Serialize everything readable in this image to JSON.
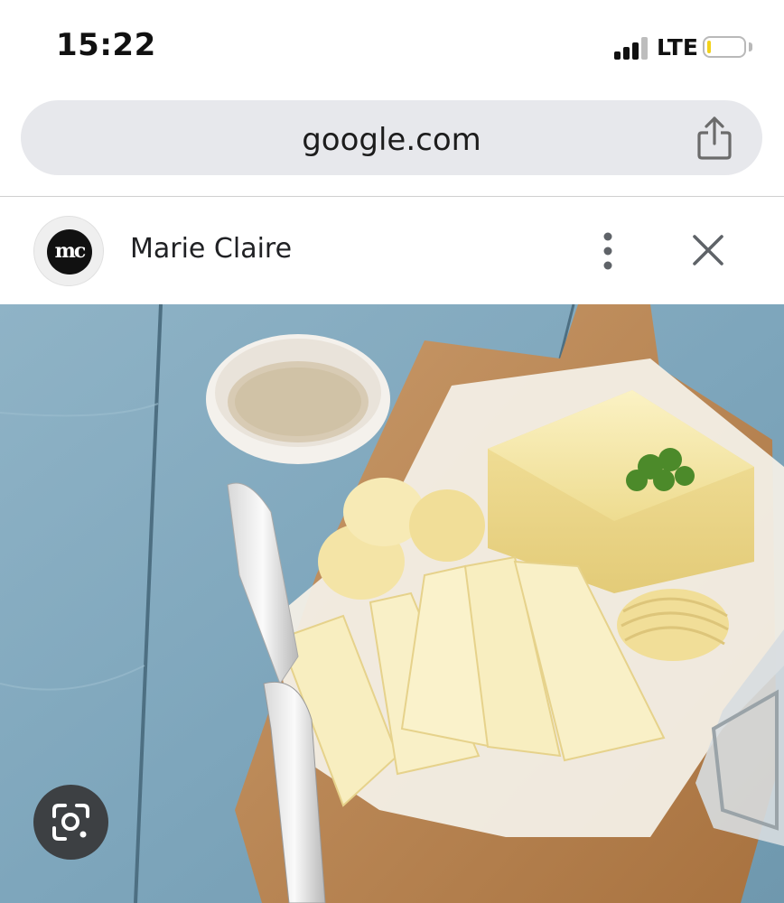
{
  "status_bar": {
    "time": "15:22",
    "network": "LTE",
    "signal_icon": "cellular-signal-icon",
    "battery_icon": "battery-icon",
    "battery_level": 0.1,
    "battery_color": "#f2d21b"
  },
  "browser": {
    "url": "google.com",
    "share_icon": "share-icon"
  },
  "source": {
    "logo_text": "mc",
    "name": "Marie Claire",
    "more_icon": "more-vertical-icon",
    "close_icon": "close-icon"
  },
  "image": {
    "subject": "butter-photo",
    "lens_icon": "google-lens-icon"
  },
  "colors": {
    "url_bar_bg": "#e7e8ec",
    "lens_button_bg": "#3d4043"
  }
}
